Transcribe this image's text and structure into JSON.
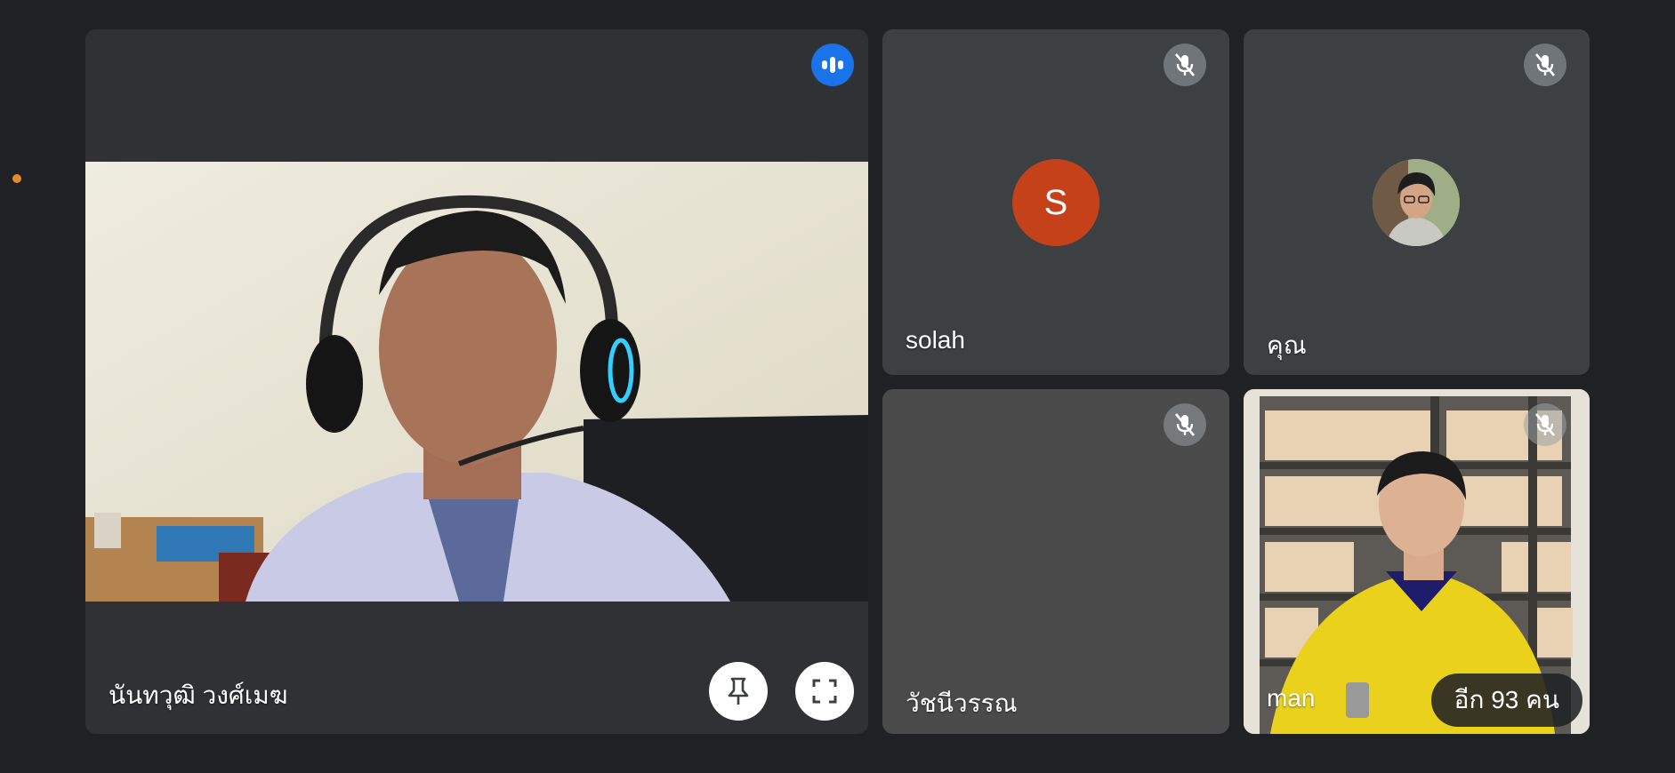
{
  "participants": {
    "main": {
      "name": "นันทวุฒิ วงศ์เมฆ",
      "pin_label": "pin-icon",
      "fullscreen_label": "fullscreen-icon"
    },
    "solah": {
      "name": "solah",
      "initial": "S",
      "avatar_color": "#c5411a"
    },
    "you": {
      "name": "คุณ"
    },
    "watchanee": {
      "name": "วัชนีวรรณ"
    },
    "man": {
      "name": "man"
    }
  },
  "overflow": {
    "label": "อีก 93 คน"
  },
  "colors": {
    "background": "#202124",
    "tile": "#3c4043",
    "speaking": "#1a73e8",
    "indicator_dot": "#e38a2c"
  }
}
